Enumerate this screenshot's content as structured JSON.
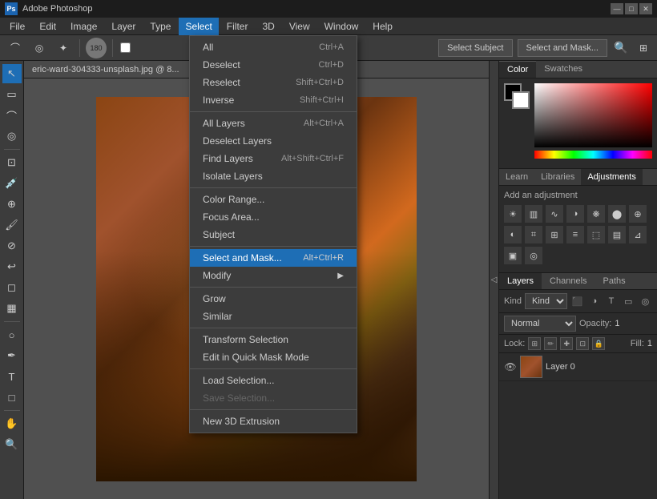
{
  "titleBar": {
    "appName": "Adobe Photoshop",
    "icon": "Ps",
    "windowControls": [
      "—",
      "□",
      "✕"
    ]
  },
  "menuBar": {
    "items": [
      "File",
      "Edit",
      "Image",
      "Layer",
      "Type",
      "Select",
      "Filter",
      "3D",
      "View",
      "Window",
      "Help"
    ]
  },
  "toolbar": {
    "selectSubjectLabel": "Select Subject",
    "selectMaskLabel": "Select and Mask...",
    "circleValue": "180"
  },
  "canvasTab": {
    "filename": "eric-ward-304333-unsplash.jpg @ 8..."
  },
  "selectMenu": {
    "items": [
      {
        "label": "All",
        "shortcut": "Ctrl+A",
        "disabled": false
      },
      {
        "label": "Deselect",
        "shortcut": "Ctrl+D",
        "disabled": false
      },
      {
        "label": "Reselect",
        "shortcut": "Shift+Ctrl+D",
        "disabled": false
      },
      {
        "label": "Inverse",
        "shortcut": "Shift+Ctrl+I",
        "disabled": false
      },
      {
        "separator": true
      },
      {
        "label": "All Layers",
        "shortcut": "Alt+Ctrl+A",
        "disabled": false
      },
      {
        "label": "Deselect Layers",
        "shortcut": "",
        "disabled": false
      },
      {
        "label": "Find Layers",
        "shortcut": "Alt+Shift+Ctrl+F",
        "disabled": false
      },
      {
        "label": "Isolate Layers",
        "shortcut": "",
        "disabled": false
      },
      {
        "separator": true
      },
      {
        "label": "Color Range...",
        "shortcut": "",
        "disabled": false
      },
      {
        "label": "Focus Area...",
        "shortcut": "",
        "disabled": false
      },
      {
        "label": "Subject",
        "shortcut": "",
        "disabled": false
      },
      {
        "separator": true
      },
      {
        "label": "Select and Mask...",
        "shortcut": "Alt+Ctrl+R",
        "highlighted": true,
        "disabled": false
      },
      {
        "label": "Modify",
        "shortcut": "",
        "hasSubmenu": true,
        "disabled": false
      },
      {
        "separator": true
      },
      {
        "label": "Grow",
        "shortcut": "",
        "disabled": false
      },
      {
        "label": "Similar",
        "shortcut": "",
        "disabled": false
      },
      {
        "separator": true
      },
      {
        "label": "Transform Selection",
        "shortcut": "",
        "disabled": false
      },
      {
        "label": "Edit in Quick Mask Mode",
        "shortcut": "",
        "disabled": false
      },
      {
        "separator": true
      },
      {
        "label": "Load Selection...",
        "shortcut": "",
        "disabled": false
      },
      {
        "label": "Save Selection...",
        "shortcut": "",
        "disabled": true
      },
      {
        "separator": true
      },
      {
        "label": "New 3D Extrusion",
        "shortcut": "",
        "disabled": false
      }
    ]
  },
  "colorPanel": {
    "tabs": [
      "Color",
      "Swatches"
    ],
    "activeTab": "Color"
  },
  "adjPanel": {
    "tabs": [
      "Learn",
      "Libraries",
      "Adjustments"
    ],
    "activeTab": "Adjustments",
    "sectionLabel": "Add an adjustment"
  },
  "layersPanel": {
    "tabs": [
      "Layers",
      "Channels",
      "Paths"
    ],
    "activeTab": "Layers",
    "filterLabel": "Kind",
    "blendMode": "Normal",
    "opacityLabel": "Opacity:",
    "opacityValue": "1",
    "lockLabel": "Lock:",
    "fillLabel": "Fill:",
    "fillValue": "1",
    "layers": [
      {
        "name": "Layer 0",
        "visible": true
      }
    ]
  }
}
